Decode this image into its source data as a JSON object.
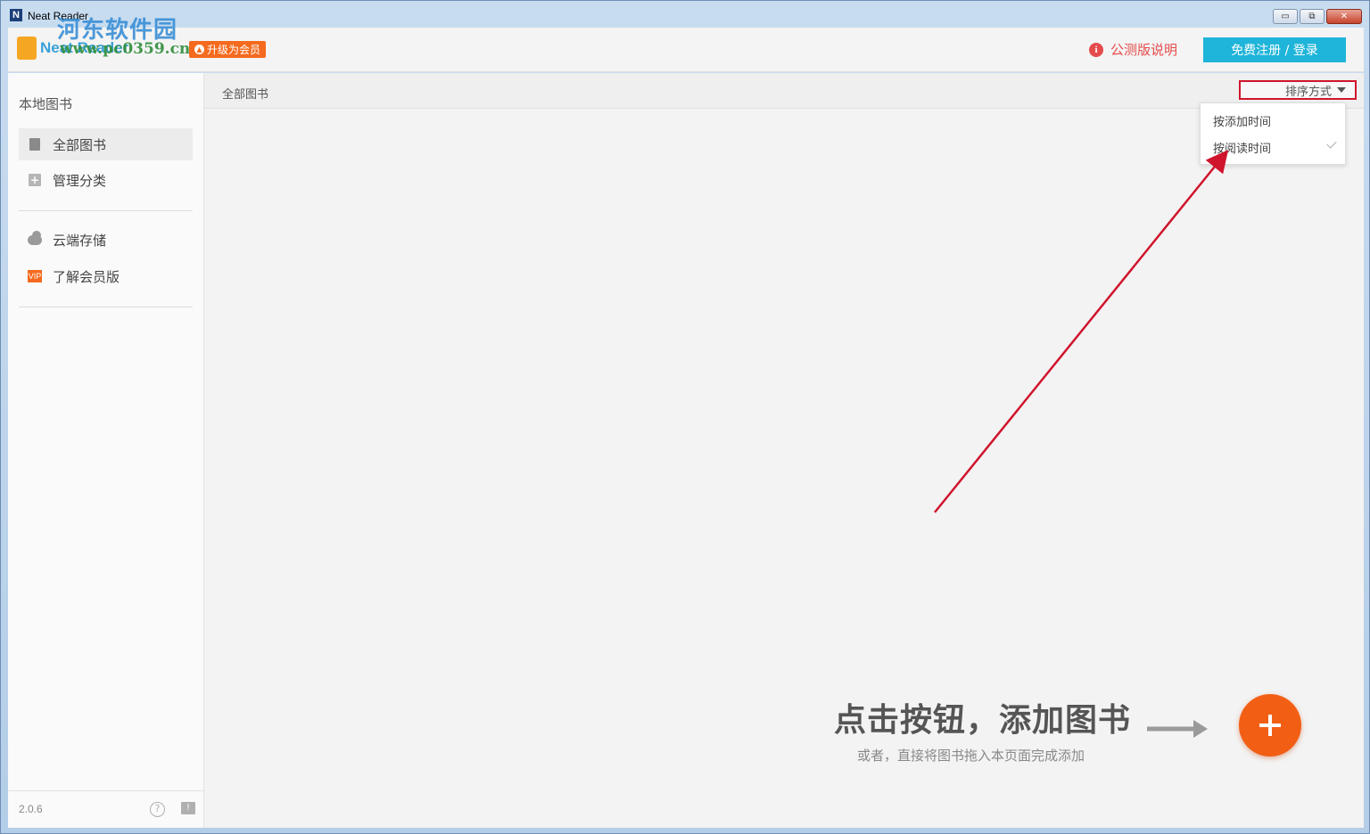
{
  "window": {
    "title": "Neat Reader",
    "app_icon": "N",
    "controls": {
      "minimize": "▭",
      "restore": "⧉",
      "close": "✕"
    }
  },
  "header": {
    "logo_text": "Neat Reader",
    "watermark_cn": "河东软件园",
    "watermark_url": "www.pc0359.cn",
    "upgrade_label": "升级为会员",
    "beta_label": "公测版说明",
    "login_label": "免费注册 / 登录",
    "accent": "#1fb4d9",
    "warn_color": "#e54b4b",
    "badge_color": "#f56a1e"
  },
  "sidebar": {
    "heading": "本地图书",
    "items": [
      {
        "label": "全部图书",
        "icon": "book-icon",
        "active": true
      },
      {
        "label": "管理分类",
        "icon": "plus-box-icon",
        "active": false
      },
      {
        "label": "云端存储",
        "icon": "cloud-icon",
        "active": false
      },
      {
        "label": "了解会员版",
        "icon": "vip-icon",
        "active": false
      }
    ],
    "vip_badge": "VIP",
    "version": "2.0.6",
    "help_glyph": "?",
    "feedback_glyph": "!"
  },
  "main": {
    "breadcrumb": "全部图书",
    "sort_label": "排序方式",
    "sort_options": [
      {
        "label": "按添加时间",
        "selected": false
      },
      {
        "label": "按阅读时间",
        "selected": true
      }
    ],
    "cta_title": "点击按钮，添加图书",
    "cta_sub": "或者，直接将图书拖入本页面完成添加",
    "add_color": "#f25f14"
  }
}
